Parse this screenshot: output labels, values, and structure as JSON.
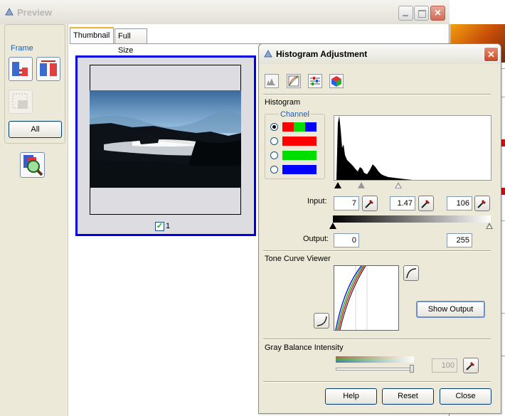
{
  "preview": {
    "title": "Preview",
    "tabs": [
      {
        "label": "Thumbnail"
      },
      {
        "label": "Full Size"
      }
    ],
    "frame_label": "Frame",
    "all_button": "All",
    "thumbnail_checked": true,
    "thumbnail_number": "1"
  },
  "histogram_dialog": {
    "title": "Histogram Adjustment",
    "close_glyph": "✕",
    "section_histogram": "Histogram",
    "channel_label": "Channel",
    "channels": [
      {
        "colors": [
          "#ff0000",
          "#00dd00",
          "#0000ff"
        ],
        "selected": true
      },
      {
        "colors": [
          "#ff0000"
        ],
        "selected": false
      },
      {
        "colors": [
          "#00dd00"
        ],
        "selected": false
      },
      {
        "colors": [
          "#0000ff"
        ],
        "selected": false
      }
    ],
    "input_label": "Input:",
    "input_low": "7",
    "input_gamma": "1.47",
    "input_high": "106",
    "output_label": "Output:",
    "output_low": "0",
    "output_high": "255",
    "section_tone_curve": "Tone Curve Viewer",
    "show_output_button": "Show Output",
    "section_gray_balance": "Gray Balance Intensity",
    "gray_balance_value": "100",
    "help_button": "Help",
    "reset_button": "Reset",
    "close_button": "Close"
  },
  "colors": {
    "selection_border": "#0000e0",
    "accent_tab": "#f2b13a"
  }
}
